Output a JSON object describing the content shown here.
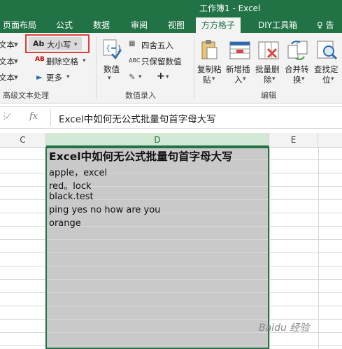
{
  "window": {
    "title": "工作簿1 - Excel"
  },
  "tabs": [
    {
      "label": "页面布局"
    },
    {
      "label": "公式"
    },
    {
      "label": "数据"
    },
    {
      "label": "审阅"
    },
    {
      "label": "视图"
    },
    {
      "label": "方方格子",
      "active": true
    },
    {
      "label": "DIY工具箱"
    },
    {
      "label": "♀ 告"
    }
  ],
  "ribbon": {
    "text_group": {
      "left_stub": [
        "文本",
        "文本",
        "文本"
      ],
      "case_button": "大小写",
      "delete_spaces": "删除空格",
      "more": "更多",
      "label": "高级文本处理"
    },
    "number_group": {
      "value_button": "数值",
      "round": "四舍五入",
      "keep_values": "只保留数值",
      "plus": "+",
      "label": "数值录入"
    },
    "edit_group": {
      "copy_paste": [
        "复制粘",
        "贴"
      ],
      "insert": [
        "新增插",
        "入"
      ],
      "batch_delete": [
        "批量删",
        "除"
      ],
      "merge": [
        "合并转",
        "换"
      ],
      "find": [
        "查找定",
        "位"
      ],
      "label": "编辑"
    }
  },
  "formula_bar": {
    "cancel": "✓",
    "fx": "fx",
    "content": "Excel中如何无公式批量句首字母大写"
  },
  "columns": [
    "C",
    "D",
    "E"
  ],
  "cells": [
    "Excel中如何无公式批量句首字母大写",
    "apple，excel",
    "red。lock",
    "black.test",
    "ping yes no how are you",
    "orange"
  ],
  "watermark": "Baidu 经验",
  "colors": {
    "excel_green": "#217346",
    "highlight": "#e0403a"
  }
}
